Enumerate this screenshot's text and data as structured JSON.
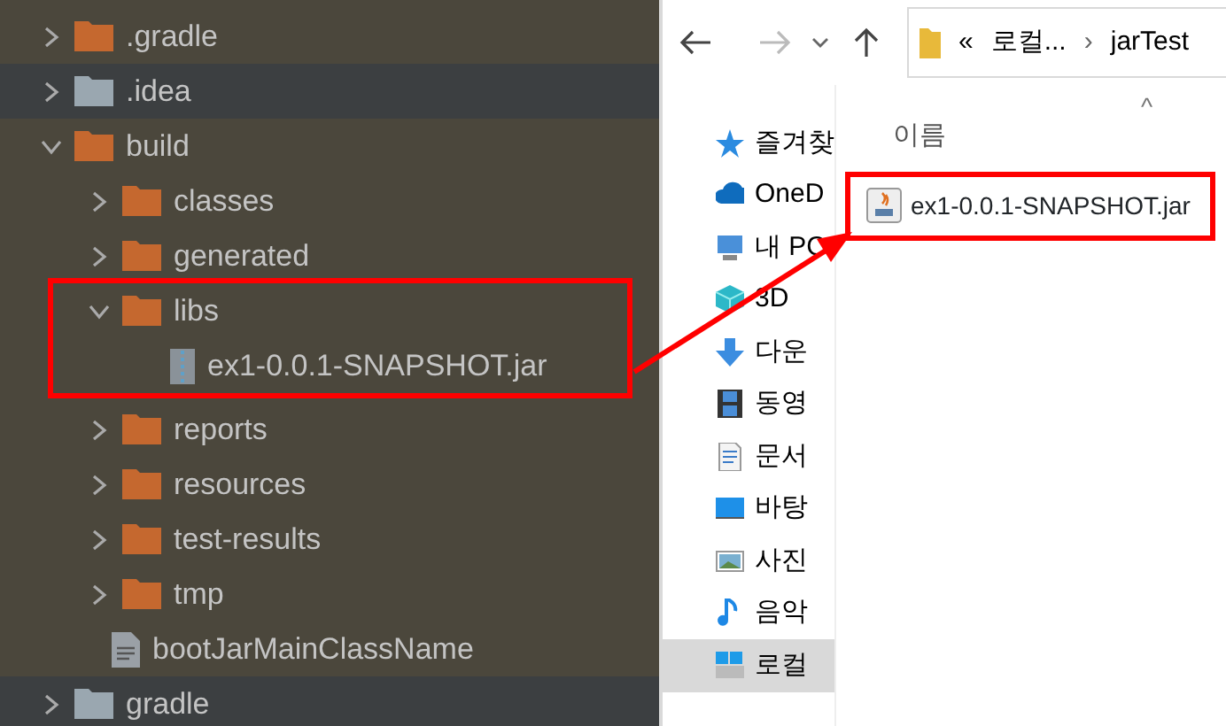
{
  "project_tree": [
    {
      "label": ".gradle",
      "kind": "folder",
      "color": "#c5682f",
      "expanded": false,
      "highlighted": false,
      "row_dark": false
    },
    {
      "label": ".idea",
      "kind": "folder",
      "color": "#9aa7b0",
      "expanded": false,
      "highlighted": false,
      "row_dark": true
    },
    {
      "label": "build",
      "kind": "folder",
      "color": "#c5682f",
      "expanded": true,
      "highlighted": false,
      "row_dark": false,
      "children": [
        {
          "label": "classes",
          "kind": "folder",
          "color": "#c5682f",
          "expanded": false,
          "highlighted": false,
          "row_dark": false
        },
        {
          "label": "generated",
          "kind": "folder",
          "color": "#c5682f",
          "expanded": false,
          "highlighted": false,
          "row_dark": false
        },
        {
          "label": "libs",
          "kind": "folder",
          "color": "#c5682f",
          "expanded": true,
          "highlighted": true,
          "row_dark": false,
          "children": [
            {
              "label": "ex1-0.0.1-SNAPSHOT.jar",
              "kind": "jar",
              "highlighted": false,
              "row_dark": false
            }
          ]
        },
        {
          "label": "reports",
          "kind": "folder",
          "color": "#c5682f",
          "expanded": false,
          "highlighted": false,
          "row_dark": false
        },
        {
          "label": "resources",
          "kind": "folder",
          "color": "#c5682f",
          "expanded": false,
          "highlighted": false,
          "row_dark": false
        },
        {
          "label": "test-results",
          "kind": "folder",
          "color": "#c5682f",
          "expanded": false,
          "highlighted": false,
          "row_dark": false
        },
        {
          "label": "tmp",
          "kind": "folder",
          "color": "#c5682f",
          "expanded": false,
          "highlighted": false,
          "row_dark": false
        },
        {
          "label": "bootJarMainClassName",
          "kind": "file",
          "highlighted": false,
          "row_dark": false
        }
      ]
    },
    {
      "label": "gradle",
      "kind": "folder",
      "color": "#9aa7b0",
      "expanded": false,
      "highlighted": false,
      "row_dark": true
    }
  ],
  "callout_arrow": true,
  "explorer": {
    "address": {
      "overflow": "«",
      "crumbs": [
        "로컬...",
        "jarTest"
      ],
      "separator": "›"
    },
    "column_header": "이름",
    "sort_indicator": "^",
    "nav_items": [
      {
        "label": "즐겨찾",
        "kind": "star",
        "selected": false
      },
      {
        "label": "OneD",
        "kind": "cloud",
        "selected": false
      },
      {
        "label": "내 PC",
        "kind": "pc",
        "selected": false
      },
      {
        "label": "3D",
        "kind": "cube",
        "selected": false
      },
      {
        "label": "다운",
        "kind": "download",
        "selected": false
      },
      {
        "label": "동영",
        "kind": "film",
        "selected": false
      },
      {
        "label": "문서",
        "kind": "document",
        "selected": false
      },
      {
        "label": "바탕",
        "kind": "desktop",
        "selected": false
      },
      {
        "label": "사진",
        "kind": "picture",
        "selected": false
      },
      {
        "label": "음악",
        "kind": "music",
        "selected": false
      },
      {
        "label": "로컬",
        "kind": "drive",
        "selected": true
      }
    ],
    "files": [
      {
        "name": "ex1-0.0.1-SNAPSHOT.jar",
        "highlighted": true
      }
    ]
  }
}
